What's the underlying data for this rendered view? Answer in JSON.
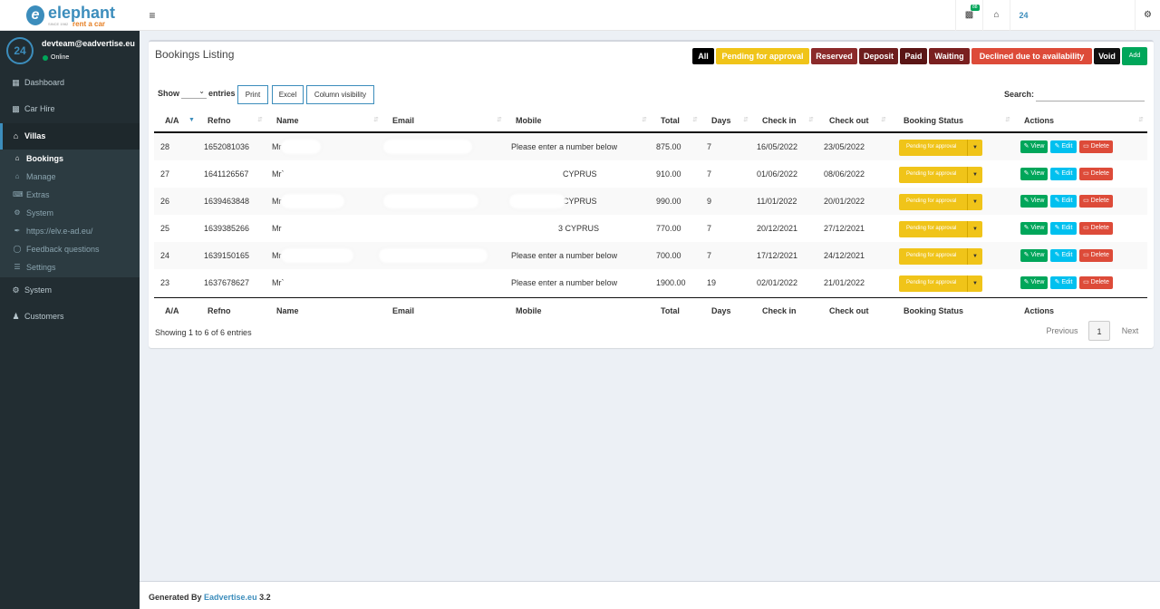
{
  "logo": {
    "word": "elephant",
    "since": "SINCE 1982",
    "sub": "rent a car"
  },
  "user": {
    "avatar_text": "24",
    "email": "devteam@eadvertise.eu",
    "status": "Online"
  },
  "nav": {
    "dashboard": "Dashboard",
    "car_hire": "Car Hire",
    "villas": "Villas",
    "system": "System",
    "customers": "Customers"
  },
  "submenu": [
    {
      "label": "Bookings",
      "icon": "home-icon"
    },
    {
      "label": "Manage",
      "icon": "home-icon"
    },
    {
      "label": "Extras",
      "icon": "keyboard-icon"
    },
    {
      "label": "System",
      "icon": "gear-icon"
    },
    {
      "label": "https://elv.e-ad.eu/",
      "icon": "wrench-icon"
    },
    {
      "label": "Feedback questions",
      "icon": "comment-icon"
    },
    {
      "label": "Settings",
      "icon": "list-icon"
    }
  ],
  "topbar": {
    "badge": "88",
    "logo24": "24"
  },
  "page": {
    "title": "Bookings Listing"
  },
  "filters": {
    "all": "All",
    "pending": "Pending for approval",
    "reserved": "Reserved",
    "deposit": "Deposit",
    "paid": "Paid",
    "waiting": "Waiting",
    "declined": "Declined due to availability",
    "void": "Void",
    "add": "Add"
  },
  "colors": {
    "all": "#000000",
    "pending": "#f0c419",
    "reserved": "#8b2a2a",
    "deposit": "#6e1e1e",
    "paid": "#5a1515",
    "waiting": "#7a2020",
    "declined": "#dd4b39",
    "void": "#111111",
    "add": "#00a65a"
  },
  "controls": {
    "show": "Show",
    "entries": "entries",
    "print": "Print",
    "excel": "Excel",
    "colvis": "Column visibility",
    "search": "Search:"
  },
  "table": {
    "headers": [
      "A/A",
      "Refno",
      "Name",
      "Email",
      "Mobile",
      "Total",
      "Days",
      "Check in",
      "Check out",
      "Booking Status",
      "Actions"
    ],
    "rows": [
      {
        "aa": "28",
        "refno": "1652081036",
        "name": "Mr",
        "mobile": "Please enter a number below",
        "total": "875.00",
        "days": "7",
        "checkin": "16/05/2022",
        "checkout": "23/05/2022",
        "status": "Pending for approval"
      },
      {
        "aa": "27",
        "refno": "1641126567",
        "name": "Mr`",
        "mobile": "CYPRUS",
        "total": "910.00",
        "days": "7",
        "checkin": "01/06/2022",
        "checkout": "08/06/2022",
        "status": "Pending for approval"
      },
      {
        "aa": "26",
        "refno": "1639463848",
        "name": "Mr",
        "mobile": "CYPRUS",
        "total": "990.00",
        "days": "9",
        "checkin": "11/01/2022",
        "checkout": "20/01/2022",
        "status": "Pending for approval"
      },
      {
        "aa": "25",
        "refno": "1639385266",
        "name": "Mr",
        "mobile": "3 CYPRUS",
        "total": "770.00",
        "days": "7",
        "checkin": "20/12/2021",
        "checkout": "27/12/2021",
        "status": "Pending for approval"
      },
      {
        "aa": "24",
        "refno": "1639150165",
        "name": "Mr",
        "mobile": "Please enter a number below",
        "total": "700.00",
        "days": "7",
        "checkin": "17/12/2021",
        "checkout": "24/12/2021",
        "status": "Pending for approval"
      },
      {
        "aa": "23",
        "refno": "1637678627",
        "name": "Mr`",
        "mobile": "Please enter a number below",
        "total": "1900.00",
        "days": "19",
        "checkin": "02/01/2022",
        "checkout": "21/01/2022",
        "status": "Pending for approval"
      }
    ],
    "actions": {
      "view": "View",
      "edit": "Edit",
      "delete": "Delete"
    }
  },
  "info": "Showing 1 to 6 of 6 entries",
  "pagination": {
    "previous": "Previous",
    "current": "1",
    "next": "Next"
  },
  "footer": {
    "prefix": "Generated By ",
    "link": "Eadvertise.eu",
    "version": " 3.2"
  }
}
